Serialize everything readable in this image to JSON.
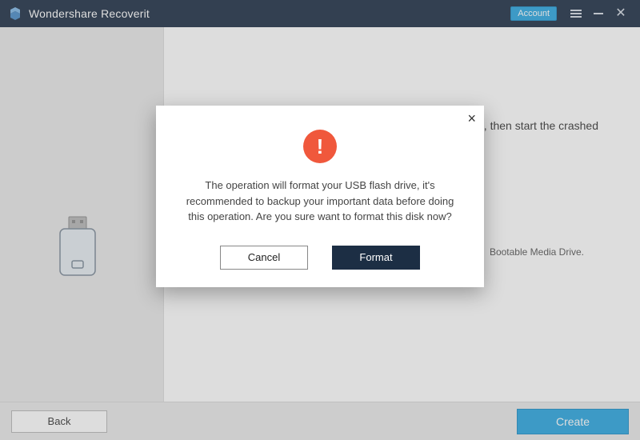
{
  "titlebar": {
    "app_title": "Wondershare Recoverit",
    "account_label": "Account"
  },
  "main": {
    "bg_line1_fragment": "rive, then start the crashed",
    "bg_hint_fragment": "Bootable Media Drive."
  },
  "footer": {
    "back_label": "Back",
    "create_label": "Create"
  },
  "dialog": {
    "message": "The operation will format your USB flash drive, it's recommended to backup your important data before doing this operation. Are you sure want to format this disk now?",
    "cancel_label": "Cancel",
    "format_label": "Format"
  }
}
